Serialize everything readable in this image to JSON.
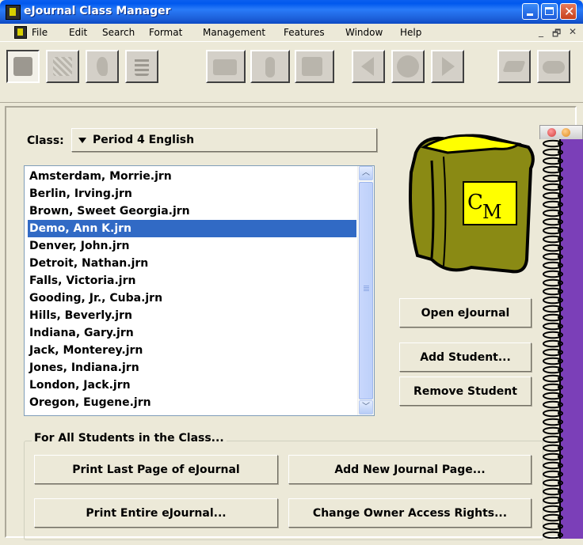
{
  "window": {
    "title": "eJournal Class Manager"
  },
  "menu": [
    "File",
    "Edit",
    "Search",
    "Format",
    "Management",
    "Features",
    "Window",
    "Help"
  ],
  "toolbar": {
    "icons": [
      "edit-journal-icon",
      "grid-icon",
      "ear-icon",
      "film-icon",
      "camera-icon",
      "microphone-icon",
      "thumbs-down-icon",
      "back-arrow-icon",
      "stop-icon",
      "forward-arrow-icon",
      "eraser-icon",
      "handshake-icon"
    ]
  },
  "class_selector": {
    "label": "Class:",
    "value": "Period 4 English"
  },
  "students": {
    "files": [
      "Amsterdam, Morrie.jrn",
      "Berlin, Irving.jrn",
      "Brown, Sweet Georgia.jrn",
      "Demo, Ann K.jrn",
      "Denver, John.jrn",
      "Detroit, Nathan.jrn",
      "Falls, Victoria.jrn",
      "Gooding, Jr., Cuba.jrn",
      "Hills, Beverly.jrn",
      "Indiana, Gary.jrn",
      "Jack, Monterey.jrn",
      "Jones, Indiana.jrn",
      "London, Jack.jrn",
      "Oregon, Eugene.jrn"
    ],
    "selected": "Demo, Ann K.jrn"
  },
  "logo": {
    "c": "C",
    "m": "M"
  },
  "actions": {
    "open": "Open eJournal",
    "add": "Add Student...",
    "remove": "Remove Student"
  },
  "all_students": {
    "title": "For All Students in the Class...",
    "print_last": "Print Last Page of eJournal",
    "add_page": "Add New Journal Page...",
    "print_entire": "Print Entire eJournal...",
    "change_rights": "Change Owner Access Rights..."
  },
  "colors": {
    "selection": "#316AC5",
    "titlebar": "#0058EE",
    "binder_purple": "#7B3FB8",
    "book_olive": "#8A8A14",
    "logo_yellow": "#FFFF00"
  }
}
